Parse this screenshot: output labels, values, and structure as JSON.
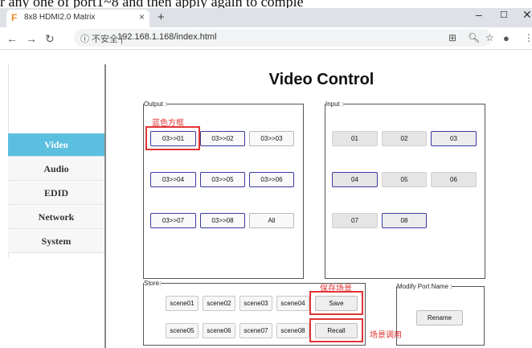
{
  "top_banner_text": "r any one of port1~8 and then apply again to comple",
  "browser": {
    "tab_title": "8x8 HDMI2.0 Matrix",
    "favicon": "F",
    "url_security": "ⓘ 不安全 |",
    "url": "192.168.1.168/index.html",
    "window_min": "–",
    "window_max": "☐",
    "window_close": "✕",
    "new_tab": "+",
    "tab_close": "×"
  },
  "sidebar": {
    "items": [
      {
        "label": "Video",
        "active": true
      },
      {
        "label": "Audio",
        "active": false
      },
      {
        "label": "EDID",
        "active": false
      },
      {
        "label": "Network",
        "active": false
      },
      {
        "label": "System",
        "active": false
      }
    ]
  },
  "main": {
    "title": "Video Control",
    "output": {
      "legend": "Output :",
      "buttons": [
        "03>>01",
        "03>>02",
        "03>>03",
        "03>>04",
        "03>>05",
        "03>>06",
        "03>>07",
        "03>>08",
        "All"
      ]
    },
    "input": {
      "legend": "Input :",
      "buttons": [
        "01",
        "02",
        "03",
        "04",
        "05",
        "06",
        "07",
        "08"
      ]
    },
    "store": {
      "legend": "Store:",
      "scenes": [
        "scene01",
        "scene02",
        "scene03",
        "scene04",
        "scene05",
        "scene06",
        "scene07",
        "scene08"
      ],
      "save_label": "Save",
      "recall_label": "Recall"
    },
    "modify": {
      "legend": "Modify Port Name :",
      "rename_label": "Rename"
    }
  },
  "annotations": {
    "blue_box": "蓝色方框",
    "save_scene": "保存场景",
    "recall_scene": "场景调用"
  },
  "colors": {
    "active_nav": "#5bbfe0",
    "highlight_border": "#3a3aa0",
    "annotation_red": "#e23535"
  }
}
